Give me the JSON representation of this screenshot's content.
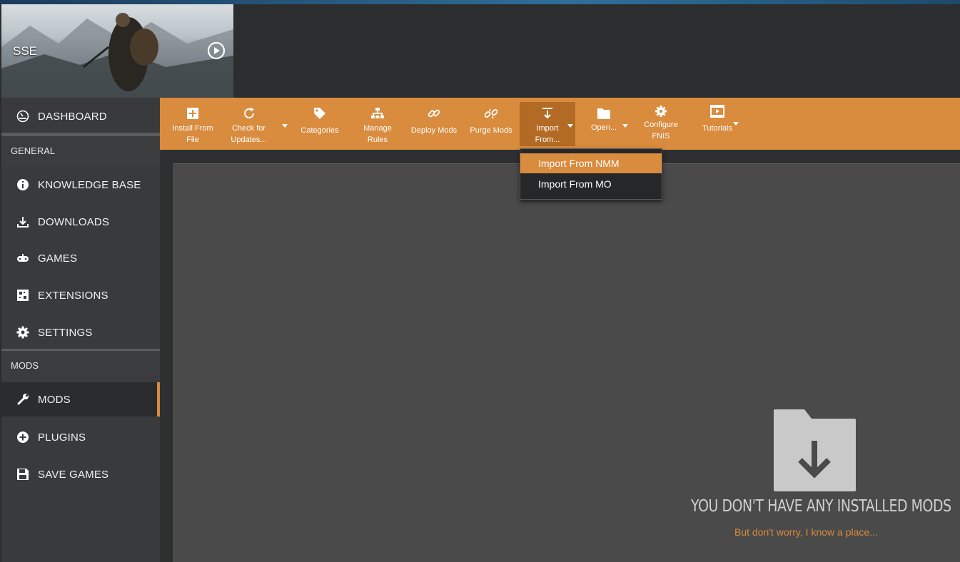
{
  "header": {
    "game_name": "SSE"
  },
  "sidebar": {
    "dashboard": "DASHBOARD",
    "section_general": "GENERAL",
    "general_items": [
      {
        "label": "KNOWLEDGE BASE",
        "icon": "info-icon"
      },
      {
        "label": "DOWNLOADS",
        "icon": "download-icon"
      },
      {
        "label": "GAMES",
        "icon": "gamepad-icon"
      },
      {
        "label": "EXTENSIONS",
        "icon": "extensions-icon"
      },
      {
        "label": "SETTINGS",
        "icon": "gear-icon"
      }
    ],
    "section_mods": "MODS",
    "mods_items": [
      {
        "label": "MODS",
        "icon": "wrench-icon",
        "active": true
      },
      {
        "label": "PLUGINS",
        "icon": "plus-circle-icon"
      },
      {
        "label": "SAVE GAMES",
        "icon": "save-icon"
      }
    ]
  },
  "toolbar": {
    "install_from_file": [
      "Install From",
      "File"
    ],
    "check_for_updates": [
      "Check for",
      "Updates..."
    ],
    "categories": "Categories",
    "manage_rules": [
      "Manage",
      "Rules"
    ],
    "deploy_mods": "Deploy Mods",
    "purge_mods": "Purge Mods",
    "import_from": [
      "Import",
      "From..."
    ],
    "open": "Open...",
    "configure_fnis": [
      "Configure",
      "FNIS"
    ],
    "tutorials": "Tutorials"
  },
  "import_menu": {
    "items": [
      "Import From NMM",
      "Import From MO"
    ],
    "highlighted": 0
  },
  "empty_state": {
    "title": "YOU DON'T HAVE ANY INSTALLED MODS",
    "subtitle": "But don't worry, I know a place..."
  },
  "colors": {
    "accent": "#d98b3e",
    "sidebar": "#383a3c",
    "panel": "#4a4a4a"
  }
}
